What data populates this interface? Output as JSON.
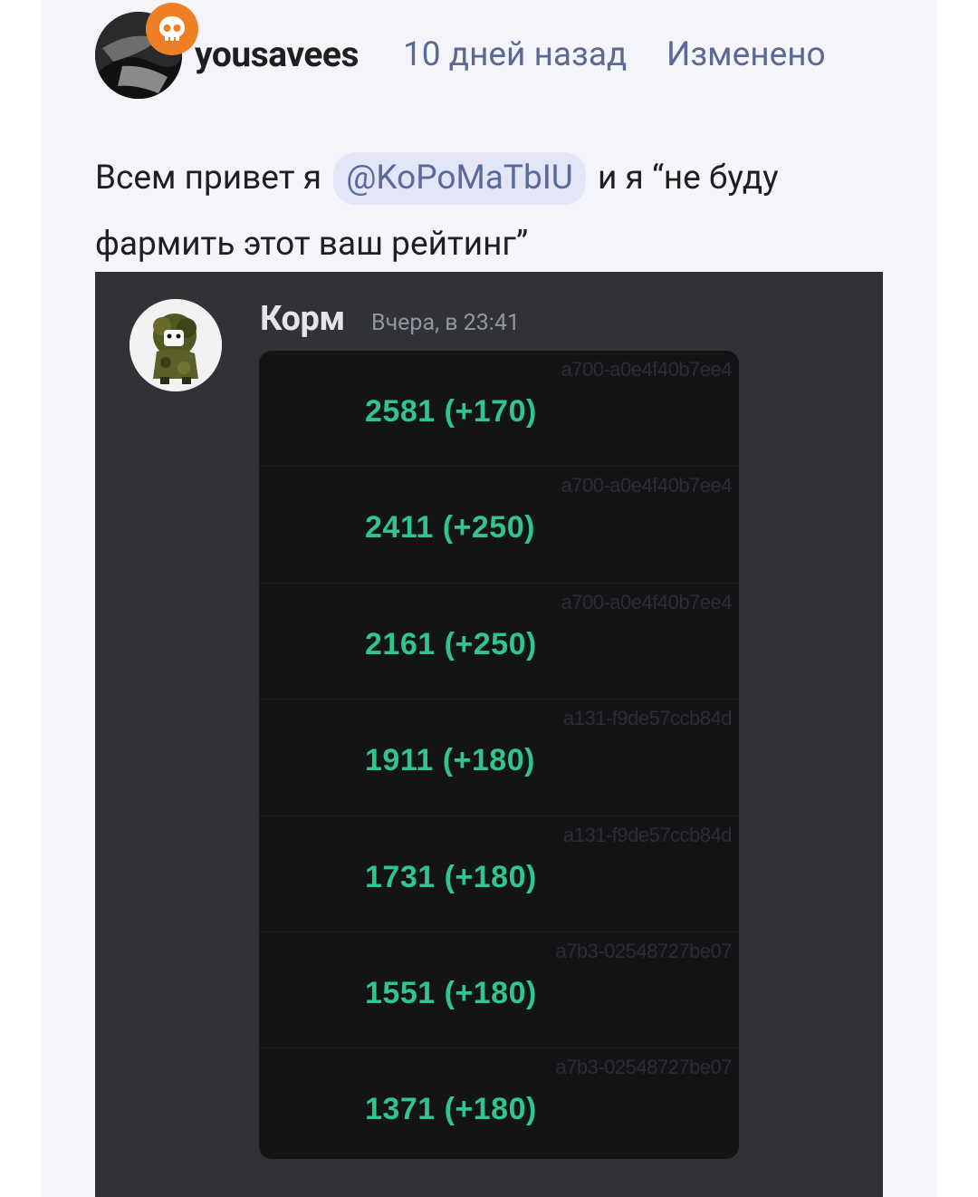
{
  "post": {
    "username": "yousavees",
    "time": "10 дней назад",
    "edited": "Изменено",
    "text_before": "Всем привет я",
    "mention": "@KoPoMaTbIU",
    "text_after": "и я “не буду фармить этот ваш рейтинг”",
    "badge_icon": "skull-icon",
    "badge_color": "#ee7f24"
  },
  "screenshot": {
    "author": "Корм",
    "time": "Вчера, в 23:41",
    "accent_color": "#2fc58c",
    "rows": [
      {
        "id": "a700-a0e4f40b7ee4",
        "value": "2581 (+170)"
      },
      {
        "id": "a700-a0e4f40b7ee4",
        "value": "2411 (+250)"
      },
      {
        "id": "a700-a0e4f40b7ee4",
        "value": "2161 (+250)"
      },
      {
        "id": "a131-f9de57ccb84d",
        "value": "1911 (+180)"
      },
      {
        "id": "a131-f9de57ccb84d",
        "value": "1731 (+180)"
      },
      {
        "id": "a7b3-02548727be07",
        "value": "1551 (+180)"
      },
      {
        "id": "a7b3-02548727be07",
        "value": "1371 (+180)"
      }
    ]
  }
}
